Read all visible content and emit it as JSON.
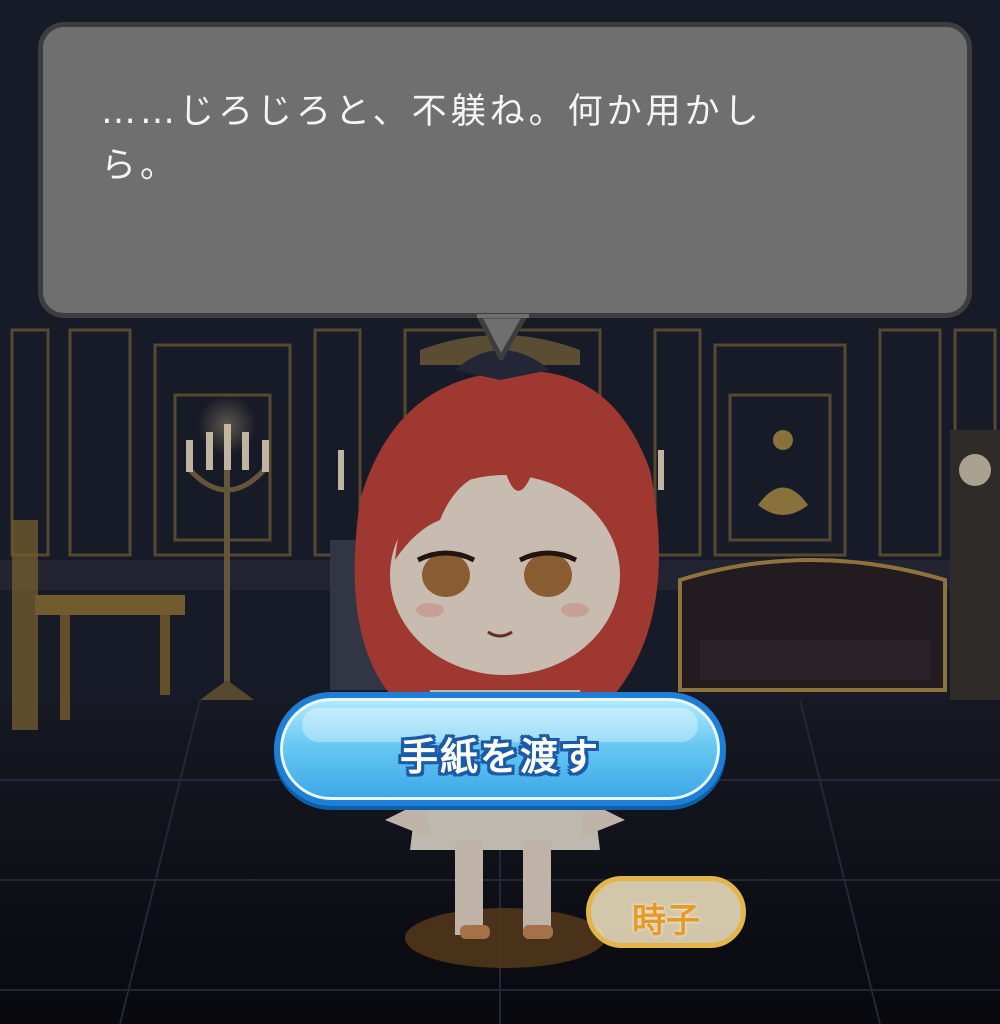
{
  "dialogue": {
    "text": "……じろじろと、不躾ね。何か用かし\nら。"
  },
  "action_button": {
    "label": "手紙を渡す"
  },
  "character": {
    "name": "時子"
  },
  "colors": {
    "bubble": "#6f6f6f",
    "bubble_border": "#3d3d3d",
    "button_blue": "#3aa6e6",
    "name_gold": "#e3b54a",
    "hair": "#c2453c"
  },
  "icons": [
    "candelabra",
    "grandfather-clock",
    "sofa",
    "side-table"
  ]
}
